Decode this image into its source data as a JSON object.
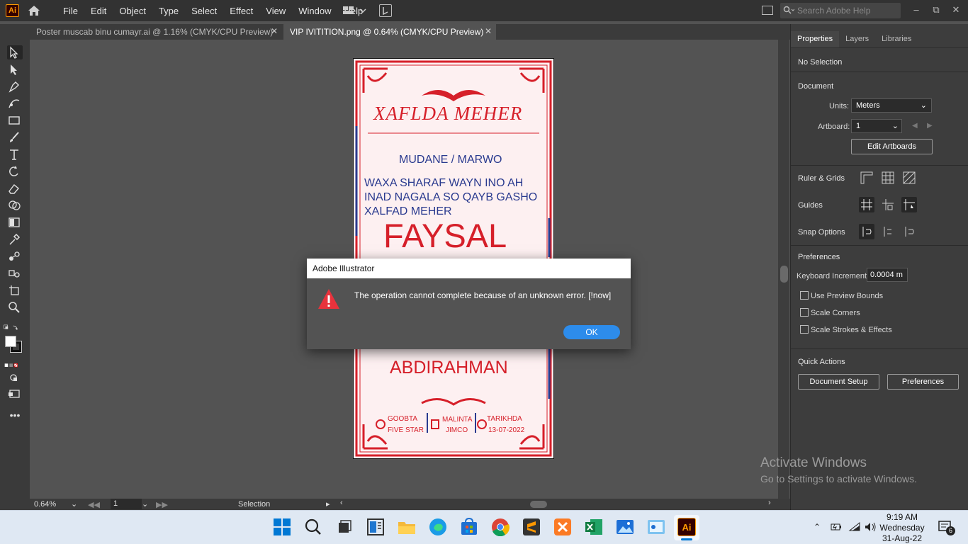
{
  "app": {
    "logo": "Ai",
    "menu": [
      "File",
      "Edit",
      "Object",
      "Type",
      "Select",
      "Effect",
      "View",
      "Window",
      "Help"
    ],
    "search_placeholder": "Search Adobe Help"
  },
  "tabs": [
    {
      "label": "Poster muscab binu cumayr.ai @ 1.16% (CMYK/CPU Preview)",
      "active": false
    },
    {
      "label": "VIP IVITITION.png @ 0.64% (CMYK/CPU Preview)",
      "active": true
    }
  ],
  "status": {
    "zoom": "0.64%",
    "artboard": "1",
    "tool": "Selection"
  },
  "poster": {
    "title": "XAFLDA MEHER",
    "subtitle": "MUDANE / MARWO",
    "line1": "WAXA SHARAF WAYN INO AH",
    "line2": "INAD NAGALA SO QAYB GASHO",
    "line3": "XALFAD MEHER",
    "name1": "FAYSAL",
    "name2": "ABDIRAHMAN",
    "venue_label": "GOOBTA",
    "venue": "FIVE STAR",
    "host_label": "MALINTA",
    "host": "JIMCO",
    "date_label": "TARIKHDA",
    "date": "13-07-2022",
    "accent": "#d6202a",
    "blue": "#2a3a8f"
  },
  "panel": {
    "tabs": [
      "Properties",
      "Layers",
      "Libraries"
    ],
    "selection": "No Selection",
    "document": "Document",
    "units_label": "Units:",
    "units_value": "Meters",
    "artboard_label": "Artboard:",
    "artboard_value": "1",
    "edit_artboards": "Edit Artboards",
    "rulers": "Ruler & Grids",
    "guides": "Guides",
    "snap": "Snap Options",
    "preferences": "Preferences",
    "keyboard_label": "Keyboard Increment:",
    "keyboard_value": "0.0004 m",
    "use_preview_bounds": "Use Preview Bounds",
    "scale_corners": "Scale Corners",
    "scale_strokes": "Scale Strokes & Effects",
    "quick_actions": "Quick Actions",
    "document_setup": "Document Setup",
    "preferences_btn": "Preferences"
  },
  "dialog": {
    "title": "Adobe Illustrator",
    "message": "The operation cannot complete because of an unknown error.   [!now]",
    "ok": "OK"
  },
  "watermark": {
    "line1": "Activate Windows",
    "line2": "Go to Settings to activate Windows."
  },
  "taskbar": {
    "time": "9:19 AM",
    "day": "Wednesday",
    "date": "31-Aug-22",
    "notifications": "6"
  }
}
